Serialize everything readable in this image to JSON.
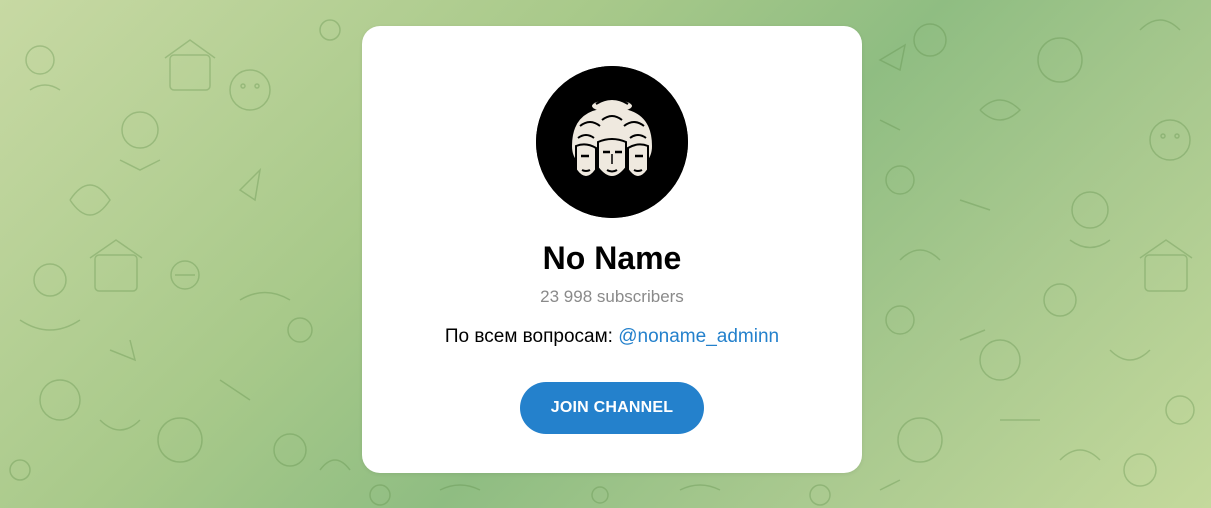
{
  "channel": {
    "title": "No Name",
    "subscribers": "23 998 subscribers",
    "description_prefix": "По всем вопросам: ",
    "description_mention": "@noname_adminn",
    "join_label": "JOIN CHANNEL",
    "avatar_icon": "three-faced-head-icon"
  },
  "colors": {
    "accent": "#2481cc",
    "muted_text": "#8a8a8a",
    "card_bg": "#ffffff",
    "avatar_bg": "#000000"
  }
}
